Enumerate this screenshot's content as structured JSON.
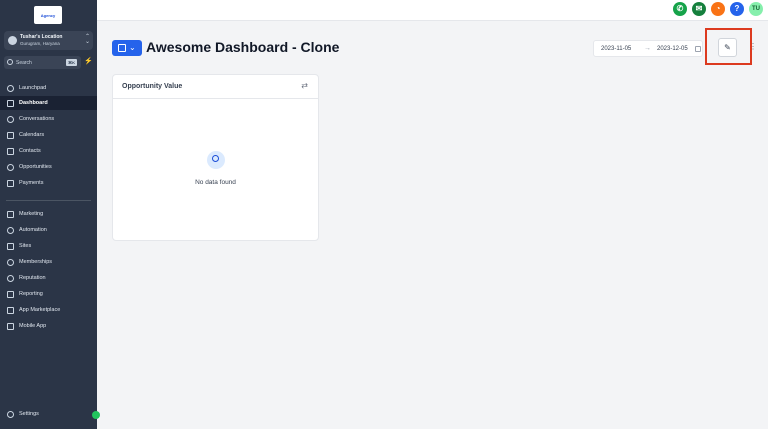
{
  "brand": {
    "logo_text": "Agency"
  },
  "location": {
    "name": "Tushar's Location",
    "subtitle": "Gurugram, Haryana"
  },
  "search": {
    "placeholder": "Search",
    "shortcut": "⌘K"
  },
  "sidebar": {
    "items": [
      {
        "label": "Launchpad",
        "icon": "rocket-icon",
        "active": false
      },
      {
        "label": "Dashboard",
        "icon": "dashboard-icon",
        "active": true
      },
      {
        "label": "Conversations",
        "icon": "chat-icon",
        "active": false
      },
      {
        "label": "Calendars",
        "icon": "calendar-icon",
        "active": false
      },
      {
        "label": "Contacts",
        "icon": "contacts-icon",
        "active": false
      },
      {
        "label": "Opportunities",
        "icon": "opportunities-icon",
        "active": false
      },
      {
        "label": "Payments",
        "icon": "payments-icon",
        "active": false
      }
    ],
    "items2": [
      {
        "label": "Marketing",
        "icon": "send-icon"
      },
      {
        "label": "Automation",
        "icon": "automation-icon"
      },
      {
        "label": "Sites",
        "icon": "sites-icon"
      },
      {
        "label": "Memberships",
        "icon": "memberships-icon"
      },
      {
        "label": "Reputation",
        "icon": "star-icon"
      },
      {
        "label": "Reporting",
        "icon": "chart-icon"
      },
      {
        "label": "App Marketplace",
        "icon": "grid-icon"
      },
      {
        "label": "Mobile App",
        "icon": "phone-icon"
      }
    ],
    "settings_label": "Settings"
  },
  "topbar": {
    "icons": [
      {
        "name": "phone-icon",
        "color": "#16a34a",
        "glyph": "✆"
      },
      {
        "name": "megaphone-icon",
        "color": "#15803d",
        "glyph": "✉"
      },
      {
        "name": "bell-icon",
        "color": "#f97316",
        "glyph": "🔔"
      },
      {
        "name": "help-icon",
        "color": "#2563eb",
        "glyph": "?"
      },
      {
        "name": "user-avatar-icon",
        "color": "#86efac",
        "glyph": "TU"
      }
    ]
  },
  "page": {
    "title": "Awesome Dashboard - Clone"
  },
  "date_range": {
    "start": "2023-11-05",
    "end": "2023-12-05"
  },
  "widget": {
    "title": "Opportunity Value",
    "empty_text": "No data found"
  },
  "colors": {
    "accent": "#2563eb",
    "highlight": "#dc3a1f",
    "sidebar_bg": "#2b3547"
  }
}
